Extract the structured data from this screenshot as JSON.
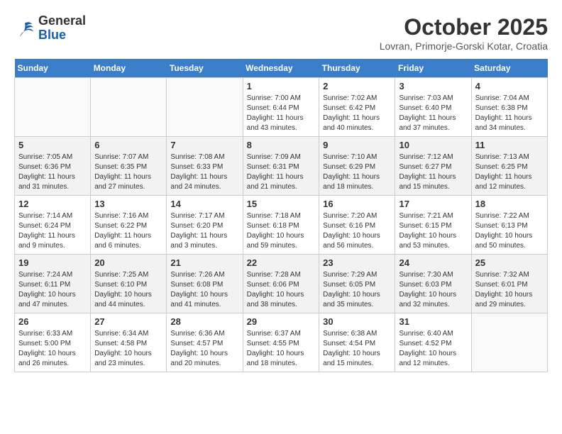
{
  "header": {
    "logo_line1": "General",
    "logo_line2": "Blue",
    "month_year": "October 2025",
    "location": "Lovran, Primorje-Gorski Kotar, Croatia"
  },
  "days_of_week": [
    "Sunday",
    "Monday",
    "Tuesday",
    "Wednesday",
    "Thursday",
    "Friday",
    "Saturday"
  ],
  "weeks": [
    [
      {
        "num": "",
        "info": ""
      },
      {
        "num": "",
        "info": ""
      },
      {
        "num": "",
        "info": ""
      },
      {
        "num": "1",
        "info": "Sunrise: 7:00 AM\nSunset: 6:44 PM\nDaylight: 11 hours and 43 minutes."
      },
      {
        "num": "2",
        "info": "Sunrise: 7:02 AM\nSunset: 6:42 PM\nDaylight: 11 hours and 40 minutes."
      },
      {
        "num": "3",
        "info": "Sunrise: 7:03 AM\nSunset: 6:40 PM\nDaylight: 11 hours and 37 minutes."
      },
      {
        "num": "4",
        "info": "Sunrise: 7:04 AM\nSunset: 6:38 PM\nDaylight: 11 hours and 34 minutes."
      }
    ],
    [
      {
        "num": "5",
        "info": "Sunrise: 7:05 AM\nSunset: 6:36 PM\nDaylight: 11 hours and 31 minutes."
      },
      {
        "num": "6",
        "info": "Sunrise: 7:07 AM\nSunset: 6:35 PM\nDaylight: 11 hours and 27 minutes."
      },
      {
        "num": "7",
        "info": "Sunrise: 7:08 AM\nSunset: 6:33 PM\nDaylight: 11 hours and 24 minutes."
      },
      {
        "num": "8",
        "info": "Sunrise: 7:09 AM\nSunset: 6:31 PM\nDaylight: 11 hours and 21 minutes."
      },
      {
        "num": "9",
        "info": "Sunrise: 7:10 AM\nSunset: 6:29 PM\nDaylight: 11 hours and 18 minutes."
      },
      {
        "num": "10",
        "info": "Sunrise: 7:12 AM\nSunset: 6:27 PM\nDaylight: 11 hours and 15 minutes."
      },
      {
        "num": "11",
        "info": "Sunrise: 7:13 AM\nSunset: 6:25 PM\nDaylight: 11 hours and 12 minutes."
      }
    ],
    [
      {
        "num": "12",
        "info": "Sunrise: 7:14 AM\nSunset: 6:24 PM\nDaylight: 11 hours and 9 minutes."
      },
      {
        "num": "13",
        "info": "Sunrise: 7:16 AM\nSunset: 6:22 PM\nDaylight: 11 hours and 6 minutes."
      },
      {
        "num": "14",
        "info": "Sunrise: 7:17 AM\nSunset: 6:20 PM\nDaylight: 11 hours and 3 minutes."
      },
      {
        "num": "15",
        "info": "Sunrise: 7:18 AM\nSunset: 6:18 PM\nDaylight: 10 hours and 59 minutes."
      },
      {
        "num": "16",
        "info": "Sunrise: 7:20 AM\nSunset: 6:16 PM\nDaylight: 10 hours and 56 minutes."
      },
      {
        "num": "17",
        "info": "Sunrise: 7:21 AM\nSunset: 6:15 PM\nDaylight: 10 hours and 53 minutes."
      },
      {
        "num": "18",
        "info": "Sunrise: 7:22 AM\nSunset: 6:13 PM\nDaylight: 10 hours and 50 minutes."
      }
    ],
    [
      {
        "num": "19",
        "info": "Sunrise: 7:24 AM\nSunset: 6:11 PM\nDaylight: 10 hours and 47 minutes."
      },
      {
        "num": "20",
        "info": "Sunrise: 7:25 AM\nSunset: 6:10 PM\nDaylight: 10 hours and 44 minutes."
      },
      {
        "num": "21",
        "info": "Sunrise: 7:26 AM\nSunset: 6:08 PM\nDaylight: 10 hours and 41 minutes."
      },
      {
        "num": "22",
        "info": "Sunrise: 7:28 AM\nSunset: 6:06 PM\nDaylight: 10 hours and 38 minutes."
      },
      {
        "num": "23",
        "info": "Sunrise: 7:29 AM\nSunset: 6:05 PM\nDaylight: 10 hours and 35 minutes."
      },
      {
        "num": "24",
        "info": "Sunrise: 7:30 AM\nSunset: 6:03 PM\nDaylight: 10 hours and 32 minutes."
      },
      {
        "num": "25",
        "info": "Sunrise: 7:32 AM\nSunset: 6:01 PM\nDaylight: 10 hours and 29 minutes."
      }
    ],
    [
      {
        "num": "26",
        "info": "Sunrise: 6:33 AM\nSunset: 5:00 PM\nDaylight: 10 hours and 26 minutes."
      },
      {
        "num": "27",
        "info": "Sunrise: 6:34 AM\nSunset: 4:58 PM\nDaylight: 10 hours and 23 minutes."
      },
      {
        "num": "28",
        "info": "Sunrise: 6:36 AM\nSunset: 4:57 PM\nDaylight: 10 hours and 20 minutes."
      },
      {
        "num": "29",
        "info": "Sunrise: 6:37 AM\nSunset: 4:55 PM\nDaylight: 10 hours and 18 minutes."
      },
      {
        "num": "30",
        "info": "Sunrise: 6:38 AM\nSunset: 4:54 PM\nDaylight: 10 hours and 15 minutes."
      },
      {
        "num": "31",
        "info": "Sunrise: 6:40 AM\nSunset: 4:52 PM\nDaylight: 10 hours and 12 minutes."
      },
      {
        "num": "",
        "info": ""
      }
    ]
  ]
}
